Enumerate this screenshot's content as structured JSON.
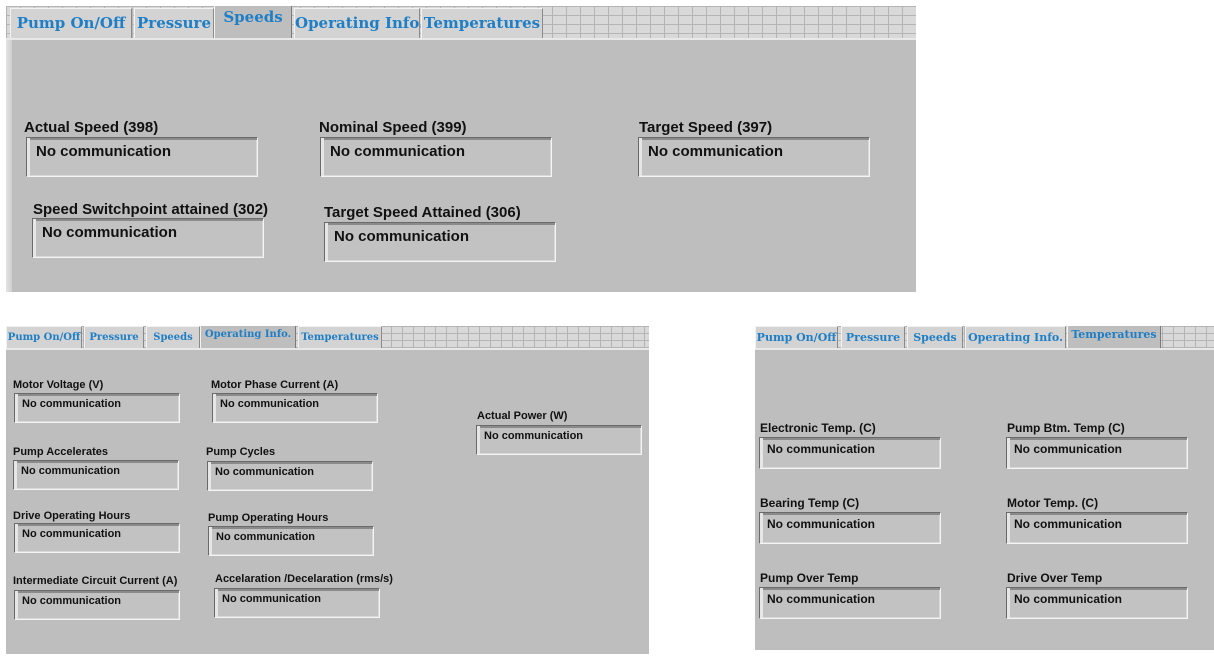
{
  "tabs": [
    "Pump On/Off",
    "Pressure",
    "Speeds",
    "Operating Info.",
    "Temperatures"
  ],
  "speeds_panel": {
    "active_tab": "Speeds",
    "fields": [
      {
        "label": "Actual Speed (398)",
        "value": "No communication"
      },
      {
        "label": "Nominal Speed (399)",
        "value": "No communication"
      },
      {
        "label": "Target Speed (397)",
        "value": "No communication"
      },
      {
        "label": "Speed Switchpoint attained (302)",
        "value": "No communication"
      },
      {
        "label": "Target Speed Attained (306)",
        "value": "No communication"
      }
    ]
  },
  "operating_panel": {
    "active_tab": "Operating Info.",
    "fields": [
      {
        "label": "Motor Voltage (V)",
        "value": "No communication"
      },
      {
        "label": "Motor Phase Current (A)",
        "value": "No communication"
      },
      {
        "label": "Actual Power (W)",
        "value": "No communication"
      },
      {
        "label": "Pump Accelerates",
        "value": "No communication"
      },
      {
        "label": "Pump Cycles",
        "value": "No communication"
      },
      {
        "label": "Drive Operating Hours",
        "value": "No communication"
      },
      {
        "label": "Pump Operating Hours",
        "value": "No communication"
      },
      {
        "label": "Intermediate Circuit Current (A)",
        "value": "No communication"
      },
      {
        "label": "Accelaration /Decelaration (rms/s)",
        "value": "No communication"
      }
    ]
  },
  "temperatures_panel": {
    "active_tab": "Temperatures",
    "fields": [
      {
        "label": "Electronic Temp. (C)",
        "value": "No communication"
      },
      {
        "label": "Pump Btm. Temp (C)",
        "value": "No communication"
      },
      {
        "label": "Bearing Temp (C)",
        "value": "No communication"
      },
      {
        "label": "Motor Temp. (C)",
        "value": "No communication"
      },
      {
        "label": "Pump Over Temp",
        "value": "No communication"
      },
      {
        "label": "Drive Over Temp",
        "value": "No communication"
      }
    ]
  },
  "colors": {
    "panel_bg": "#bebebe",
    "tab_text": "#1e7ec6",
    "tab_bg": "#d3d3d3"
  }
}
